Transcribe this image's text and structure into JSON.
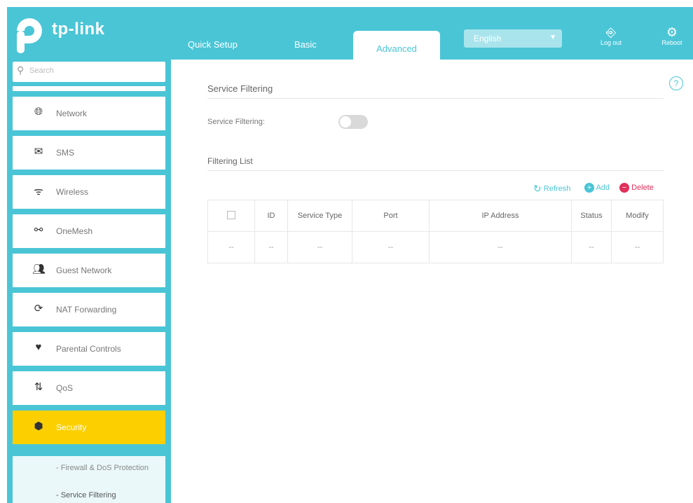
{
  "header": {
    "logo_text": "tp-link",
    "tabs": [
      {
        "label": "Quick Setup"
      },
      {
        "label": "Basic"
      },
      {
        "label": "Advanced"
      }
    ],
    "language": "English",
    "logout_label": "Log out",
    "reboot_label": "Reboot"
  },
  "sidebar": {
    "search_placeholder": "Search",
    "items": [
      {
        "label": "Network",
        "icon": "globe-icon"
      },
      {
        "label": "SMS",
        "icon": "envelope-icon"
      },
      {
        "label": "Wireless",
        "icon": "wireless-icon"
      },
      {
        "label": "OneMesh",
        "icon": "mesh-icon"
      },
      {
        "label": "Guest Network",
        "icon": "guest-icon"
      },
      {
        "label": "NAT Forwarding",
        "icon": "nat-icon"
      },
      {
        "label": "Parental Controls",
        "icon": "parental-icon"
      },
      {
        "label": "QoS",
        "icon": "qos-icon"
      },
      {
        "label": "Security",
        "icon": "shield-icon"
      }
    ],
    "submenu": [
      {
        "label": "- Firewall & DoS Protection"
      },
      {
        "label": "- Service Filtering"
      }
    ]
  },
  "main": {
    "section_title": "Service Filtering",
    "toggle_label": "Service Filtering:",
    "toggle_on": false,
    "list_title": "Filtering List",
    "actions": {
      "refresh": "Refresh",
      "add": "Add",
      "delete": "Delete"
    },
    "columns": [
      "",
      "ID",
      "Service Type",
      "Port",
      "IP Address",
      "Status",
      "Modify"
    ],
    "rows": [
      [
        "",
        "--",
        "--",
        "--",
        "--",
        "--",
        "--"
      ]
    ]
  },
  "colors": {
    "brand": "#4ac5d6",
    "active_menu": "#fbcf00",
    "delete": "#e0305b"
  }
}
